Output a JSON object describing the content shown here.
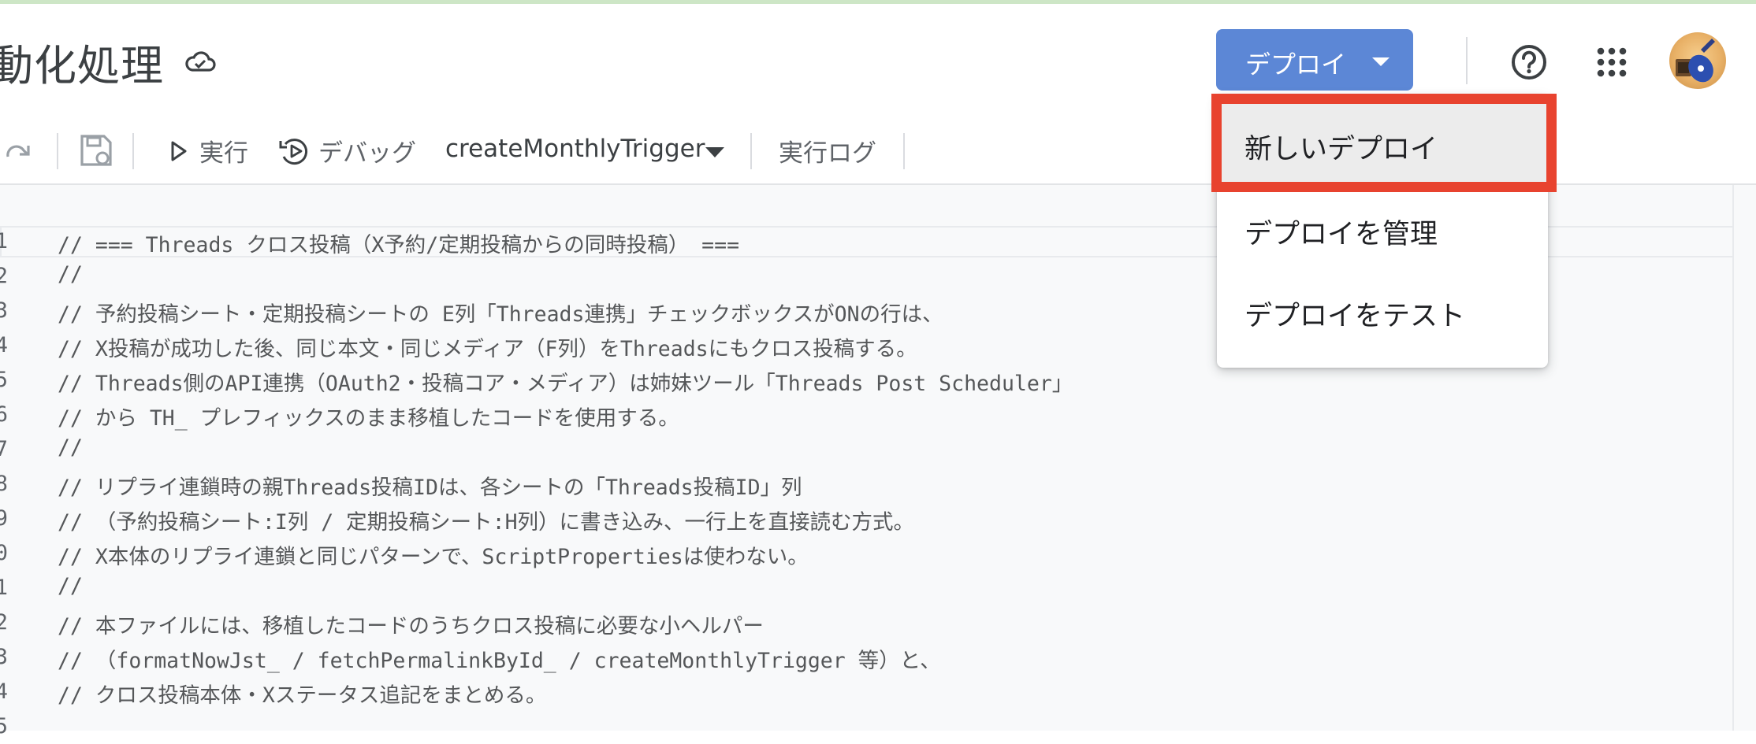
{
  "header": {
    "project_title": "動化処理",
    "deploy_button": "デプロイ"
  },
  "toolbar": {
    "run": "実行",
    "debug": "デバッグ",
    "function_name": "createMonthlyTrigger",
    "execution_log": "実行ログ"
  },
  "deploy_menu": {
    "items": [
      "新しいデプロイ",
      "デプロイを管理",
      "デプロイをテスト"
    ],
    "highlighted_index": 0
  },
  "editor": {
    "lines": [
      {
        "num": "1",
        "text": "// === Threads クロス投稿（X予約/定期投稿からの同時投稿） ==="
      },
      {
        "num": "2",
        "text": "//"
      },
      {
        "num": "3",
        "text": "// 予約投稿シート・定期投稿シートの E列「Threads連携」チェックボックスがONの行は、"
      },
      {
        "num": "4",
        "text": "// X投稿が成功した後、同じ本文・同じメディア（F列）をThreadsにもクロス投稿する。"
      },
      {
        "num": "5",
        "text": "// Threads側のAPI連携（OAuth2・投稿コア・メディア）は姉妹ツール「Threads Post Scheduler」"
      },
      {
        "num": "6",
        "text": "// から TH_ プレフィックスのまま移植したコードを使用する。"
      },
      {
        "num": "7",
        "text": "//"
      },
      {
        "num": "8",
        "text": "// リプライ連鎖時の親Threads投稿IDは、各シートの「Threads投稿ID」列"
      },
      {
        "num": "9",
        "text": "// （予約投稿シート:I列 / 定期投稿シート:H列）に書き込み、一行上を直接読む方式。"
      },
      {
        "num": "0",
        "text": "// X本体のリプライ連鎖と同じパターンで、ScriptPropertiesは使わない。"
      },
      {
        "num": "1",
        "text": "//"
      },
      {
        "num": "2",
        "text": "// 本ファイルには、移植したコードのうちクロス投稿に必要な小ヘルパー"
      },
      {
        "num": "3",
        "text": "// （formatNowJst_ / fetchPermalinkById_ / createMonthlyTrigger 等）と、"
      },
      {
        "num": "4",
        "text": "// クロス投稿本体・Xステータス追記をまとめる。"
      },
      {
        "num": "5",
        "text": ""
      }
    ]
  },
  "colors": {
    "deploy_button": "#5c87d6",
    "highlight_border": "#e8432f",
    "editor_bg": "#f8f9fa"
  }
}
